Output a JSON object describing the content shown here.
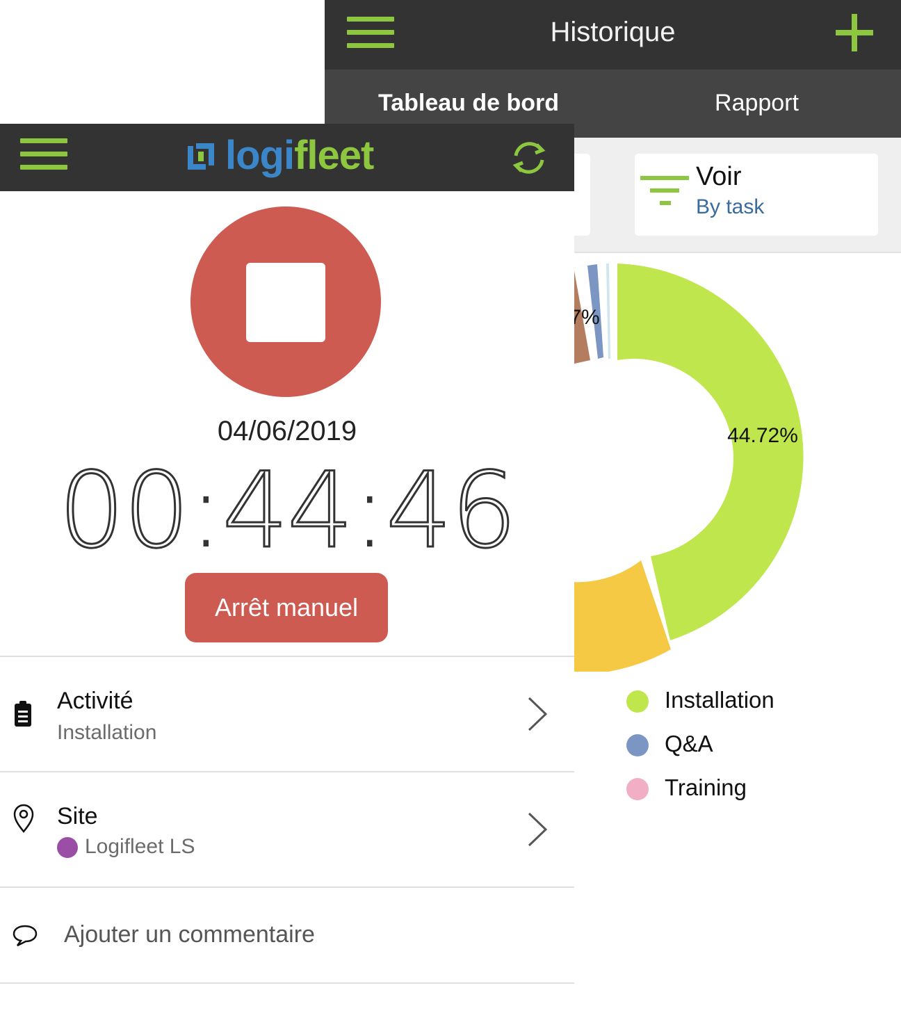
{
  "history_screen": {
    "title": "Historique",
    "tabs": [
      {
        "label": "Tableau de bord",
        "selected": true
      },
      {
        "label": "Rapport",
        "selected": false
      }
    ],
    "filter": {
      "label": "Voir",
      "value": "By task"
    },
    "accent_color": "#8dc63f"
  },
  "chart_data": {
    "type": "pie",
    "categories": [
      "Installation",
      "Q&A",
      "Training"
    ],
    "slices": [
      {
        "label": "Installation",
        "value": 44.72,
        "color": "#bfe64c"
      }
    ],
    "visible_labels": {
      "installation_pct": "44.72%",
      "partial_pct": "7%"
    },
    "legend": [
      {
        "label": "Installation",
        "color": "#bfe64c"
      },
      {
        "label": "Q&A",
        "color": "#7b96c2"
      },
      {
        "label": "Training",
        "color": "#f1aec4"
      }
    ]
  },
  "timer_screen": {
    "app_name_a": "logi",
    "app_name_b": "fleet",
    "date": "04/06/2019",
    "elapsed": {
      "h": "00",
      "m": "44",
      "s": "46",
      "sep": ":"
    },
    "manual_stop_label": "Arrêt manuel",
    "stop_color": "#cd5b52",
    "activity": {
      "title": "Activité",
      "value": "Installation"
    },
    "site": {
      "title": "Site",
      "value": "Logifleet LS",
      "color": "#9b4ea5"
    },
    "comment_placeholder": "Ajouter un commentaire"
  }
}
